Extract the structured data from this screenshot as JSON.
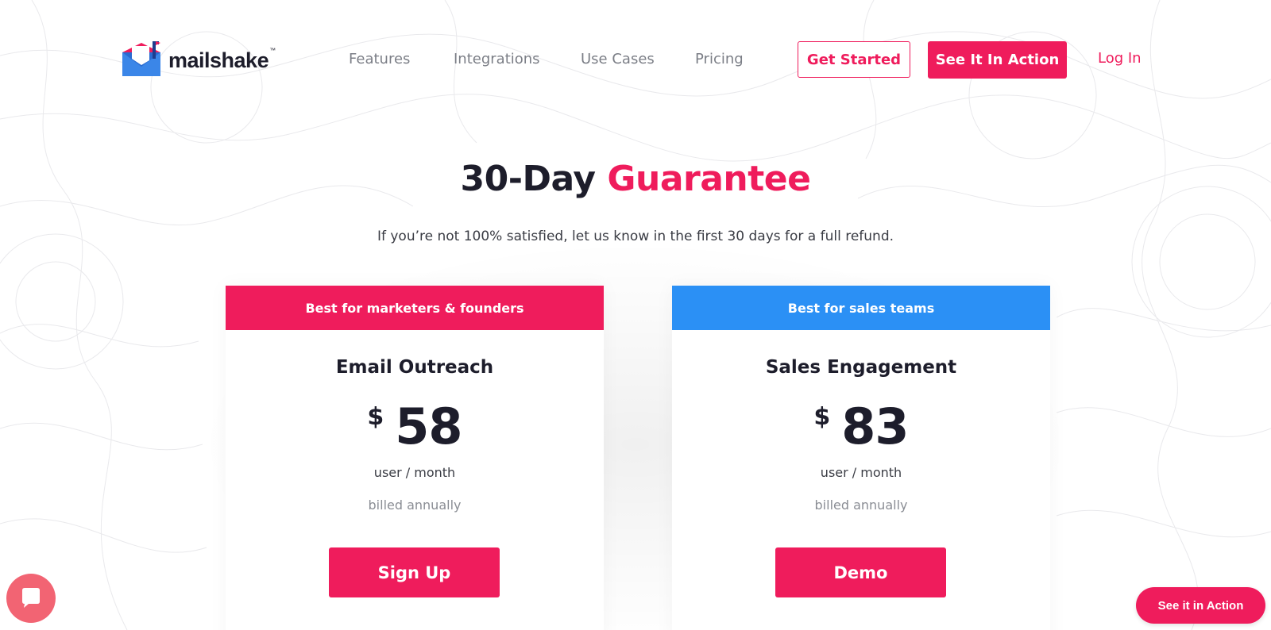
{
  "brand": {
    "name": "mailshake",
    "trademark": "™",
    "accent_color": "#ef1c5c",
    "sales_color": "#2b90f5"
  },
  "nav": {
    "items": [
      "Features",
      "Integrations",
      "Use Cases",
      "Pricing"
    ],
    "get_started": "Get Started",
    "see_in_action": "See It In Action",
    "login": "Log In"
  },
  "hero": {
    "title_main": "30-Day",
    "title_accent": "Guarantee",
    "subtitle": "If you’re not 100% satisfied, let us know in the first 30 days for a full refund."
  },
  "plans": [
    {
      "banner": "Best for marketers & founders",
      "banner_color": "#ef1c5c",
      "name": "Email Outreach",
      "currency": "$",
      "price": "58",
      "period": "user / month",
      "billing": "billed annually",
      "cta": "Sign Up"
    },
    {
      "banner": "Best for sales teams",
      "banner_color": "#2b90f5",
      "name": "Sales Engagement",
      "currency": "$",
      "price": "83",
      "period": "user / month",
      "billing": "billed annually",
      "cta": "Demo"
    }
  ],
  "widgets": {
    "chat_icon": "chat-icon",
    "floating_cta": "See it in Action"
  }
}
